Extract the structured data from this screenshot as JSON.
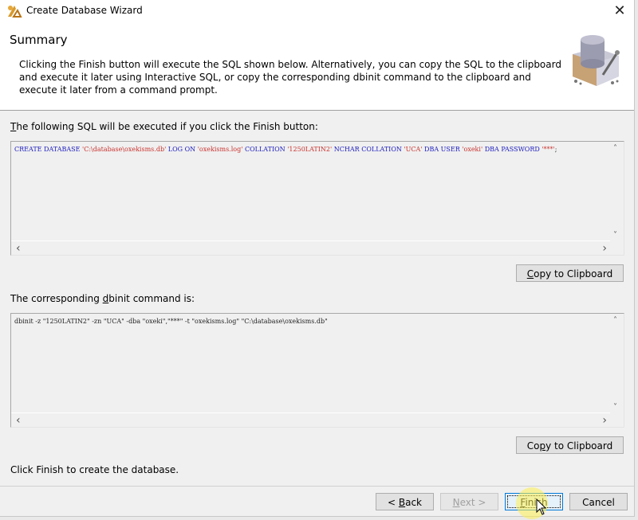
{
  "window": {
    "title": "Create Database Wizard",
    "close_icon": "close-icon",
    "app_icon": "sybase-app-icon"
  },
  "header": {
    "title": "Summary",
    "description": "Clicking the Finish button will execute the SQL shown below. Alternatively, you can copy the SQL to the clipboard and execute it later using Interactive SQL, or copy the corresponding dbinit command to the clipboard and execute it later from a command prompt.",
    "icon": "database-wizard-icon"
  },
  "sql_section": {
    "label_mnemonic": "T",
    "label_rest": "he following SQL will be executed if you click the Finish button:",
    "code_tokens": [
      {
        "t": "kw",
        "v": "CREATE DATABASE "
      },
      {
        "t": "str",
        "v": "'C:\\database\\oxekisms.db'"
      },
      {
        "t": "kw",
        "v": " LOG ON "
      },
      {
        "t": "str",
        "v": "'oxekisms.log'"
      },
      {
        "t": "kw",
        "v": " COLLATION "
      },
      {
        "t": "str",
        "v": "'1250LATIN2'"
      },
      {
        "t": "kw",
        "v": " NCHAR COLLATION "
      },
      {
        "t": "str",
        "v": "'UCA'"
      },
      {
        "t": "kw",
        "v": " DBA USER "
      },
      {
        "t": "str",
        "v": "'oxeki'"
      },
      {
        "t": "kw",
        "v": " DBA PASSWORD "
      },
      {
        "t": "str",
        "v": "'***'"
      },
      {
        "t": "plain",
        "v": ";"
      }
    ],
    "copy_button": {
      "mnemonic": "C",
      "rest": "opy to Clipboard"
    }
  },
  "dbinit_section": {
    "label_pre": "The corresponding ",
    "label_mnemonic": "d",
    "label_post": "binit command is:",
    "command": "dbinit -z \"1250LATIN2\" -zn \"UCA\" -dba \"oxeki\",\"***\" -t \"oxekisms.log\" \"C:\\database\\oxekisms.db\"",
    "copy_button": {
      "pre": "Co",
      "mnemonic": "p",
      "rest": "y to Clipboard"
    }
  },
  "footer": {
    "hint": "Click Finish to create the database.",
    "buttons": {
      "back": {
        "pre": "< ",
        "mnemonic": "B",
        "rest": "ack",
        "enabled": true
      },
      "next": {
        "mnemonic": "N",
        "rest": "ext >",
        "enabled": false
      },
      "finish": {
        "mnemonic": "F",
        "rest": "inish",
        "enabled": true,
        "focused": true
      },
      "cancel": {
        "label": "Cancel",
        "enabled": true
      }
    }
  },
  "scroll_arrows": {
    "up": "˄",
    "down": "˅",
    "left": "‹",
    "right": "›"
  }
}
